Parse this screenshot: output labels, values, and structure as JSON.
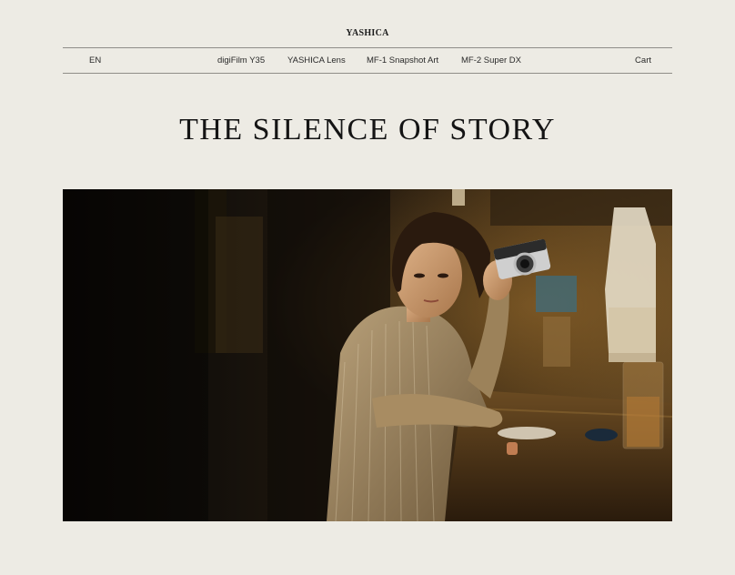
{
  "brand": {
    "logo_text": "YASHICA"
  },
  "nav": {
    "language": "EN",
    "items": [
      {
        "label": "digiFilm Y35"
      },
      {
        "label": "YASHICA Lens"
      },
      {
        "label": "MF-1 Snapshot Art"
      },
      {
        "label": "MF-2 Super DX"
      }
    ],
    "cart": "Cart"
  },
  "hero": {
    "headline": "THE SILENCE OF STORY",
    "image_subject": "woman-holding-camera-at-bar-counter"
  },
  "colors": {
    "background": "#edebe4",
    "text": "#1a1a1a",
    "rule": "#8f8d88"
  }
}
